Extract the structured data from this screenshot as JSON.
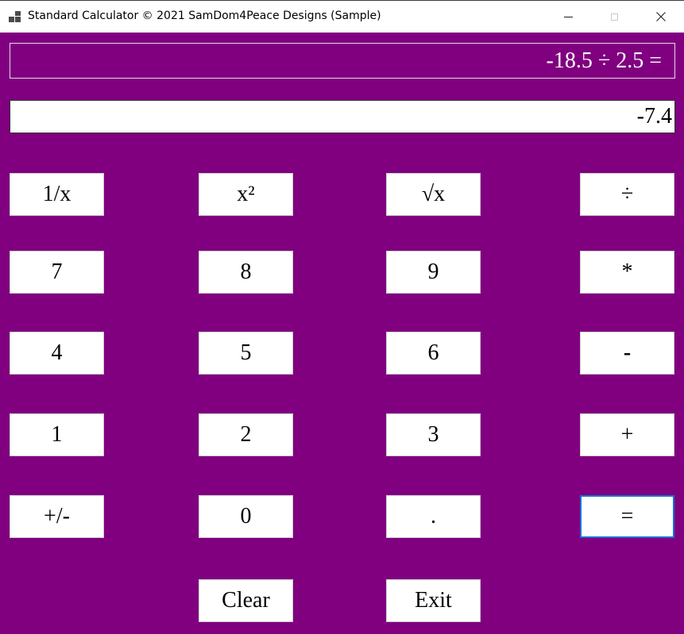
{
  "window": {
    "title": "Standard Calculator © 2021 SamDom4Peace Designs (Sample)",
    "controls": {
      "minimize": "minimize-icon",
      "maximize": "maximize-icon",
      "close": "close-icon"
    }
  },
  "colors": {
    "background": "#800080",
    "key_background": "#ffffff",
    "focus_border": "#1a6fd4"
  },
  "expression": "-18.5 ÷ 2.5 =",
  "display": "-7.4",
  "keys": {
    "reciprocal": "1/x",
    "square": "x²",
    "sqrt": "√x",
    "divide": "÷",
    "seven": "7",
    "eight": "8",
    "nine": "9",
    "multiply": "*",
    "four": "4",
    "five": "5",
    "six": "6",
    "subtract": "-",
    "one": "1",
    "two": "2",
    "three": "3",
    "add": "+",
    "negate": "+/-",
    "zero": "0",
    "decimal": ".",
    "equals": "=",
    "clear": "Clear",
    "exit": "Exit"
  }
}
